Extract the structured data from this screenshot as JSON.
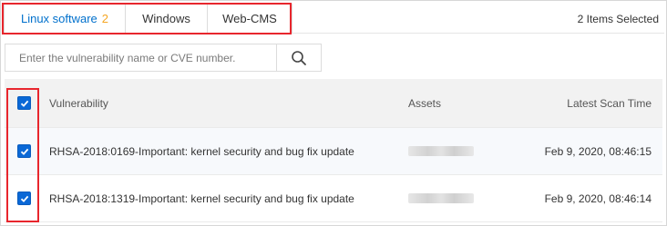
{
  "tabs": [
    {
      "label": "Linux software",
      "count": "2"
    },
    {
      "label": "Windows"
    },
    {
      "label": "Web-CMS"
    }
  ],
  "selected_count": "2 Items Selected",
  "search": {
    "placeholder": "Enter the vulnerability name or CVE number.",
    "icon": "search-icon"
  },
  "table": {
    "headers": {
      "vulnerability": "Vulnerability",
      "assets": "Assets",
      "scan_time": "Latest Scan Time"
    },
    "rows": [
      {
        "name": "RHSA-2018:0169-Important: kernel security and bug fix update",
        "scan_time": "Feb 9, 2020, 08:46:15",
        "checked": true
      },
      {
        "name": "RHSA-2018:1319-Important: kernel security and bug fix update",
        "scan_time": "Feb 9, 2020, 08:46:14",
        "checked": true
      }
    ]
  },
  "colors": {
    "accent": "#0070cc",
    "count": "#f5a623",
    "highlight": "#e8262d",
    "checkbox": "#0a68d6"
  }
}
